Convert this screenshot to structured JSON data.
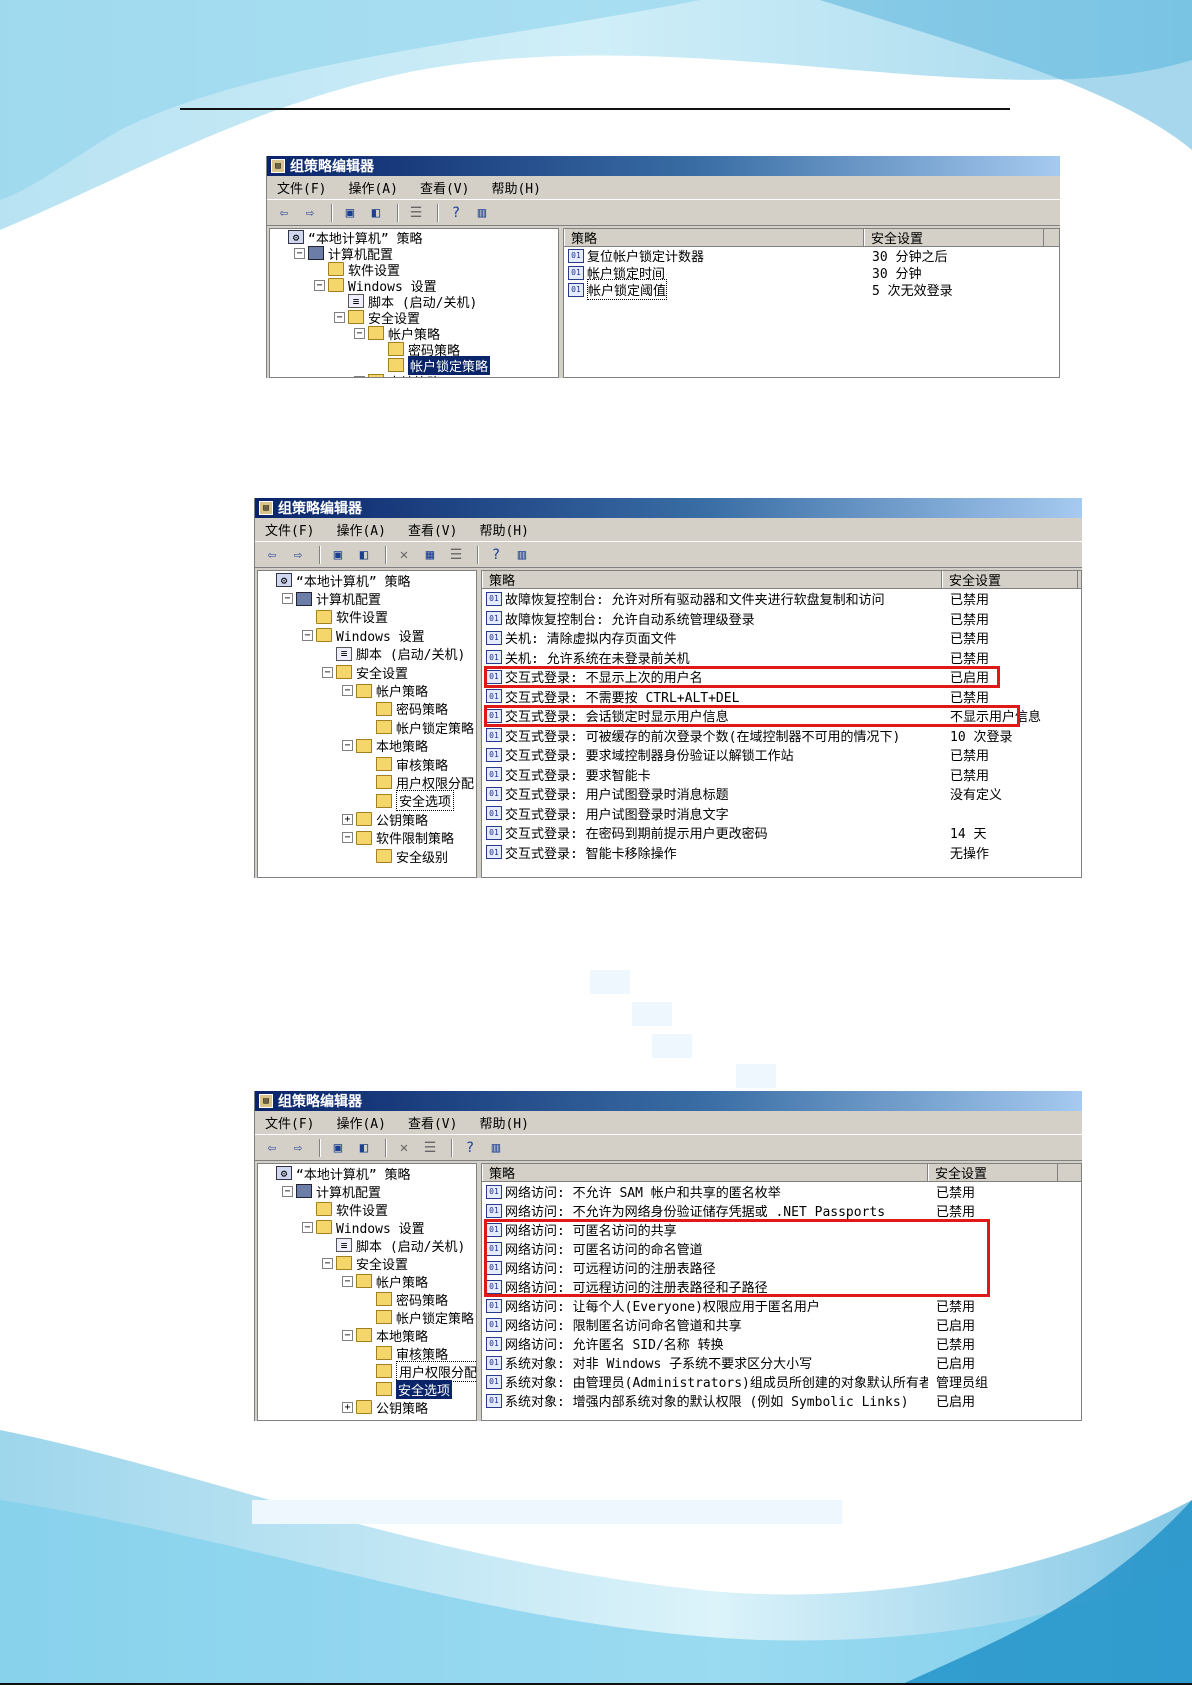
{
  "windows": [
    {
      "title": "组策略编辑器",
      "menus": [
        "文件(F)",
        "操作(A)",
        "查看(V)",
        "帮助(H)"
      ],
      "tree": [
        {
          "label": "“本地计算机” 策略",
          "level": 0,
          "toggle": "",
          "icon": "policy"
        },
        {
          "label": "计算机配置",
          "level": 1,
          "toggle": "−",
          "icon": "comp"
        },
        {
          "label": "软件设置",
          "level": 2,
          "toggle": "",
          "icon": "folder"
        },
        {
          "label": "Windows 设置",
          "level": 2,
          "toggle": "−",
          "icon": "folder"
        },
        {
          "label": "脚本 (启动/关机)",
          "level": 3,
          "toggle": "",
          "icon": "script"
        },
        {
          "label": "安全设置",
          "level": 3,
          "toggle": "−",
          "icon": "lockfolder"
        },
        {
          "label": "帐户策略",
          "level": 4,
          "toggle": "−",
          "icon": "lockfolder"
        },
        {
          "label": "密码策略",
          "level": 5,
          "toggle": "",
          "icon": "lockfolder"
        },
        {
          "label": "帐户锁定策略",
          "level": 5,
          "toggle": "",
          "icon": "lockfolder",
          "state": "selected"
        },
        {
          "label": "本地策略",
          "level": 4,
          "toggle": "+",
          "icon": "lockfolder"
        }
      ],
      "columns": [
        "策略",
        "安全设置"
      ],
      "rows": [
        {
          "policy": "复位帐户锁定计数器",
          "setting": "30 分钟之后"
        },
        {
          "policy": "帐户锁定时间",
          "setting": "30 分钟"
        },
        {
          "policy": "帐户锁定阈值",
          "setting": "5 次无效登录",
          "focus": true
        }
      ]
    },
    {
      "title": "组策略编辑器",
      "menus": [
        "文件(F)",
        "操作(A)",
        "查看(V)",
        "帮助(H)"
      ],
      "tree": [
        {
          "label": "“本地计算机” 策略",
          "level": 0,
          "toggle": "",
          "icon": "policy"
        },
        {
          "label": "计算机配置",
          "level": 1,
          "toggle": "−",
          "icon": "comp"
        },
        {
          "label": "软件设置",
          "level": 2,
          "toggle": "",
          "icon": "folder"
        },
        {
          "label": "Windows 设置",
          "level": 2,
          "toggle": "−",
          "icon": "folder"
        },
        {
          "label": "脚本 (启动/关机)",
          "level": 3,
          "toggle": "",
          "icon": "script"
        },
        {
          "label": "安全设置",
          "level": 3,
          "toggle": "−",
          "icon": "lockfolder"
        },
        {
          "label": "帐户策略",
          "level": 4,
          "toggle": "−",
          "icon": "lockfolder"
        },
        {
          "label": "密码策略",
          "level": 5,
          "toggle": "",
          "icon": "lockfolder"
        },
        {
          "label": "帐户锁定策略",
          "level": 5,
          "toggle": "",
          "icon": "lockfolder"
        },
        {
          "label": "本地策略",
          "level": 4,
          "toggle": "−",
          "icon": "lockfolder"
        },
        {
          "label": "审核策略",
          "level": 5,
          "toggle": "",
          "icon": "lockfolder"
        },
        {
          "label": "用户权限分配",
          "level": 5,
          "toggle": "",
          "icon": "lockfolder"
        },
        {
          "label": "安全选项",
          "level": 5,
          "toggle": "",
          "icon": "lockfolder",
          "state": "focus"
        },
        {
          "label": "公钥策略",
          "level": 4,
          "toggle": "+",
          "icon": "folder"
        },
        {
          "label": "软件限制策略",
          "level": 4,
          "toggle": "−",
          "icon": "folder"
        },
        {
          "label": "安全级别",
          "level": 5,
          "toggle": "",
          "icon": "folder"
        }
      ],
      "columns": [
        "策略",
        "安全设置"
      ],
      "rows": [
        {
          "policy": "故障恢复控制台: 允许对所有驱动器和文件夹进行软盘复制和访问",
          "setting": "已禁用"
        },
        {
          "policy": "故障恢复控制台: 允许自动系统管理级登录",
          "setting": "已禁用"
        },
        {
          "policy": "关机: 清除虚拟内存页面文件",
          "setting": "已禁用"
        },
        {
          "policy": "关机: 允许系统在未登录前关机",
          "setting": "已禁用"
        },
        {
          "policy": "交互式登录: 不显示上次的用户名",
          "setting": "已启用"
        },
        {
          "policy": "交互式登录: 不需要按 CTRL+ALT+DEL",
          "setting": "已禁用"
        },
        {
          "policy": "交互式登录: 会话锁定时显示用户信息",
          "setting": "不显示用户信息"
        },
        {
          "policy": "交互式登录: 可被缓存的前次登录个数(在域控制器不可用的情况下)",
          "setting": "10 次登录"
        },
        {
          "policy": "交互式登录: 要求域控制器身份验证以解锁工作站",
          "setting": "已禁用"
        },
        {
          "policy": "交互式登录: 要求智能卡",
          "setting": "已禁用"
        },
        {
          "policy": "交互式登录: 用户试图登录时消息标题",
          "setting": "没有定义"
        },
        {
          "policy": "交互式登录: 用户试图登录时消息文字",
          "setting": ""
        },
        {
          "policy": "交互式登录: 在密码到期前提示用户更改密码",
          "setting": "14 天"
        },
        {
          "policy": "交互式登录: 智能卡移除操作",
          "setting": "无操作"
        }
      ]
    },
    {
      "title": "组策略编辑器",
      "menus": [
        "文件(F)",
        "操作(A)",
        "查看(V)",
        "帮助(H)"
      ],
      "tree": [
        {
          "label": "“本地计算机” 策略",
          "level": 0,
          "toggle": "",
          "icon": "policy"
        },
        {
          "label": "计算机配置",
          "level": 1,
          "toggle": "−",
          "icon": "comp"
        },
        {
          "label": "软件设置",
          "level": 2,
          "toggle": "",
          "icon": "folder"
        },
        {
          "label": "Windows 设置",
          "level": 2,
          "toggle": "−",
          "icon": "folder"
        },
        {
          "label": "脚本 (启动/关机)",
          "level": 3,
          "toggle": "",
          "icon": "script"
        },
        {
          "label": "安全设置",
          "level": 3,
          "toggle": "−",
          "icon": "lockfolder"
        },
        {
          "label": "帐户策略",
          "level": 4,
          "toggle": "−",
          "icon": "lockfolder"
        },
        {
          "label": "密码策略",
          "level": 5,
          "toggle": "",
          "icon": "lockfolder"
        },
        {
          "label": "帐户锁定策略",
          "level": 5,
          "toggle": "",
          "icon": "lockfolder"
        },
        {
          "label": "本地策略",
          "level": 4,
          "toggle": "−",
          "icon": "lockfolder"
        },
        {
          "label": "审核策略",
          "level": 5,
          "toggle": "",
          "icon": "lockfolder"
        },
        {
          "label": "用户权限分配",
          "level": 5,
          "toggle": "",
          "icon": "lockfolder",
          "state": "focus"
        },
        {
          "label": "安全选项",
          "level": 5,
          "toggle": "",
          "icon": "lockfolder",
          "state": "selected"
        },
        {
          "label": "公钥策略",
          "level": 4,
          "toggle": "+",
          "icon": "folder"
        }
      ],
      "columns": [
        "策略",
        "安全设置"
      ],
      "rows": [
        {
          "policy": "网络访问: 不允许 SAM 帐户和共享的匿名枚举",
          "setting": "已禁用"
        },
        {
          "policy": "网络访问: 不允许为网络身份验证储存凭据或 .NET Passports",
          "setting": "已禁用"
        },
        {
          "policy": "网络访问: 可匿名访问的共享",
          "setting": ""
        },
        {
          "policy": "网络访问: 可匿名访问的命名管道",
          "setting": ""
        },
        {
          "policy": "网络访问: 可远程访问的注册表路径",
          "setting": ""
        },
        {
          "policy": "网络访问: 可远程访问的注册表路径和子路径",
          "setting": ""
        },
        {
          "policy": "网络访问: 让每个人(Everyone)权限应用于匿名用户",
          "setting": "已禁用"
        },
        {
          "policy": "网络访问: 限制匿名访问命名管道和共享",
          "setting": "已启用"
        },
        {
          "policy": "网络访问: 允许匿名 SID/名称 转换",
          "setting": "已禁用"
        },
        {
          "policy": "系统对象: 对非 Windows 子系统不要求区分大小写",
          "setting": "已启用"
        },
        {
          "policy": "系统对象: 由管理员(Administrators)组成员所创建的对象默认所有者",
          "setting": "管理员组"
        },
        {
          "policy": "系统对象: 增强内部系统对象的默认权限 (例如 Symbolic Links)",
          "setting": "已启用"
        }
      ]
    }
  ]
}
